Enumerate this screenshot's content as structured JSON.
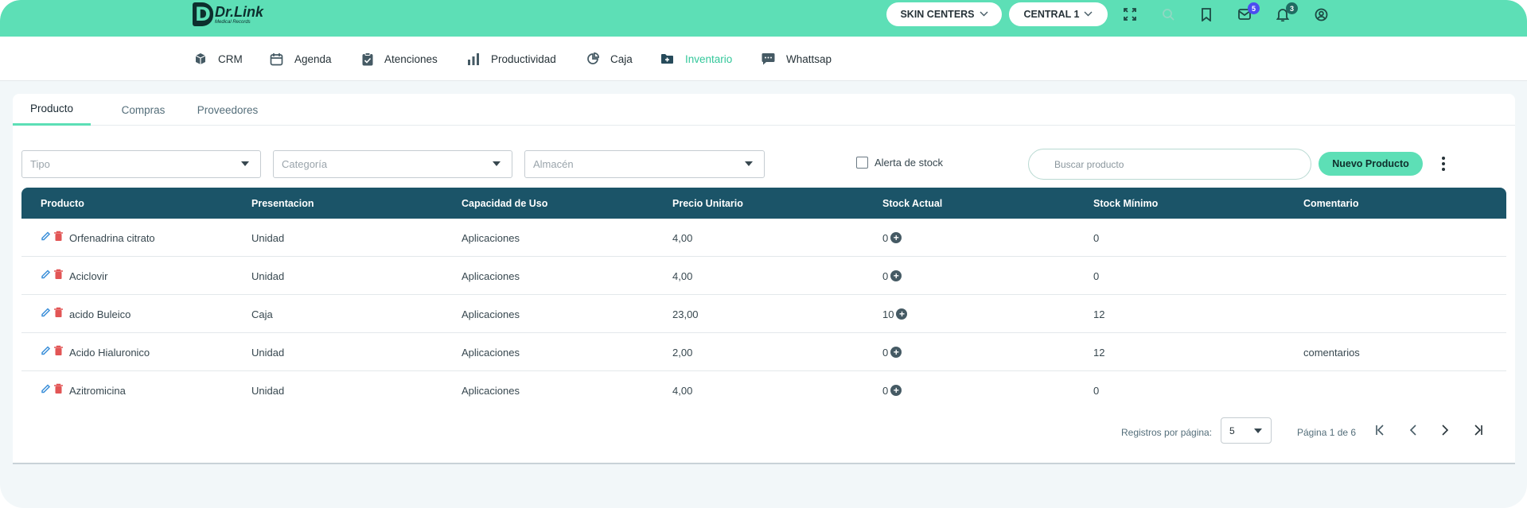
{
  "brand": {
    "logo_letter": "D",
    "name": "Dr.Link",
    "tagline": "Medical Records"
  },
  "topbar": {
    "clinic_selector": "SKIN CENTERS",
    "branch_selector": "CENTRAL 1",
    "messages_badge": "5",
    "notifications_badge": "3",
    "icons": [
      "fullscreen-icon",
      "search-icon",
      "bookmark-icon",
      "mail-icon",
      "bell-icon",
      "account-icon"
    ]
  },
  "modules": [
    {
      "label": "CRM",
      "icon": "cube-icon"
    },
    {
      "label": "Agenda",
      "icon": "calendar-icon"
    },
    {
      "label": "Atenciones",
      "icon": "clipboard-icon"
    },
    {
      "label": "Productividad",
      "icon": "bar-chart-icon"
    },
    {
      "label": "Caja",
      "icon": "pie-chart-icon"
    },
    {
      "label": "Inventario",
      "icon": "folder-plus-icon",
      "active": true
    },
    {
      "label": "Whattsap",
      "icon": "chat-icon"
    }
  ],
  "tabs": [
    {
      "label": "Producto",
      "active": true
    },
    {
      "label": "Compras"
    },
    {
      "label": "Proveedores"
    }
  ],
  "filters": {
    "tipo_placeholder": "Tipo",
    "categoria_placeholder": "Categoría",
    "almacen_placeholder": "Almacén",
    "stock_alert_label": "Alerta de stock",
    "search_placeholder": "Buscar producto",
    "new_button": "Nuevo Producto"
  },
  "table": {
    "columns": [
      "Producto",
      "Presentacion",
      "Capacidad de Uso",
      "Precio Unitario",
      "Stock Actual",
      "Stock Mínimo",
      "Comentario"
    ],
    "rows": [
      {
        "producto": "Orfenadrina citrato",
        "presentacion": "Unidad",
        "capacidad": "Aplicaciones",
        "precio": "4,00",
        "stock": "0",
        "minimo": "0",
        "comentario": ""
      },
      {
        "producto": "Aciclovir",
        "presentacion": "Unidad",
        "capacidad": "Aplicaciones",
        "precio": "4,00",
        "stock": "0",
        "minimo": "0",
        "comentario": ""
      },
      {
        "producto": "acido Buleico",
        "presentacion": "Caja",
        "capacidad": "Aplicaciones",
        "precio": "23,00",
        "stock": "10",
        "minimo": "12",
        "comentario": ""
      },
      {
        "producto": "Acido Hialuronico",
        "presentacion": "Unidad",
        "capacidad": "Aplicaciones",
        "precio": "2,00",
        "stock": "0",
        "minimo": "12",
        "comentario": "comentarios"
      },
      {
        "producto": "Azitromicina",
        "presentacion": "Unidad",
        "capacidad": "Aplicaciones",
        "precio": "4,00",
        "stock": "0",
        "minimo": "0",
        "comentario": ""
      }
    ]
  },
  "pagination": {
    "rows_per_page_label": "Registros por página:",
    "rows_per_page": "5",
    "page_info": "Página 1 de 6"
  },
  "colors": {
    "accent": "#5ddfb6",
    "header": "#1b5468",
    "delete": "#e25555",
    "edit": "#3b8fd9"
  }
}
